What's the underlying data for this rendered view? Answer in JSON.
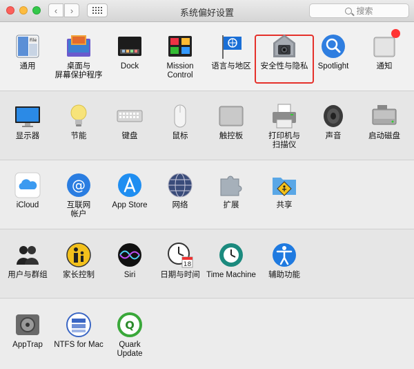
{
  "window": {
    "title": "系统偏好设置"
  },
  "toolbar": {
    "back": "‹",
    "forward": "›"
  },
  "search": {
    "placeholder": "搜索"
  },
  "rows": [
    [
      {
        "id": "general",
        "label": "通用"
      },
      {
        "id": "desktop",
        "label": "桌面与\n屏幕保护程序"
      },
      {
        "id": "dock",
        "label": "Dock"
      },
      {
        "id": "mission",
        "label": "Mission\nControl"
      },
      {
        "id": "language",
        "label": "语言与地区"
      },
      {
        "id": "security",
        "label": "安全性与隐私"
      },
      {
        "id": "spotlight",
        "label": "Spotlight"
      },
      {
        "id": "notifications",
        "label": "通知"
      }
    ],
    [
      {
        "id": "displays",
        "label": "显示器"
      },
      {
        "id": "energy",
        "label": "节能"
      },
      {
        "id": "keyboard",
        "label": "键盘"
      },
      {
        "id": "mouse",
        "label": "鼠标"
      },
      {
        "id": "trackpad",
        "label": "触控板"
      },
      {
        "id": "printers",
        "label": "打印机与\n扫描仪"
      },
      {
        "id": "sound",
        "label": "声音"
      },
      {
        "id": "startup",
        "label": "启动磁盘"
      }
    ],
    [
      {
        "id": "icloud",
        "label": "iCloud"
      },
      {
        "id": "internet",
        "label": "互联网\n帐户"
      },
      {
        "id": "appstore",
        "label": "App Store"
      },
      {
        "id": "network",
        "label": "网络"
      },
      {
        "id": "extensions",
        "label": "扩展"
      },
      {
        "id": "sharing",
        "label": "共享"
      }
    ],
    [
      {
        "id": "users",
        "label": "用户与群组"
      },
      {
        "id": "parental",
        "label": "家长控制"
      },
      {
        "id": "siri",
        "label": "Siri"
      },
      {
        "id": "datetime",
        "label": "日期与时间"
      },
      {
        "id": "timemachine",
        "label": "Time Machine"
      },
      {
        "id": "accessibility",
        "label": "辅助功能"
      }
    ],
    [
      {
        "id": "apptrap",
        "label": "AppTrap"
      },
      {
        "id": "ntfs",
        "label": "NTFS for Mac"
      },
      {
        "id": "quark",
        "label": "Quark\nUpdate"
      }
    ]
  ],
  "icons": {
    "calendar_day": "18",
    "un_glyph": "◎"
  },
  "colors": {
    "highlight": "#e5302a",
    "notify_badge": "#ff3333"
  }
}
